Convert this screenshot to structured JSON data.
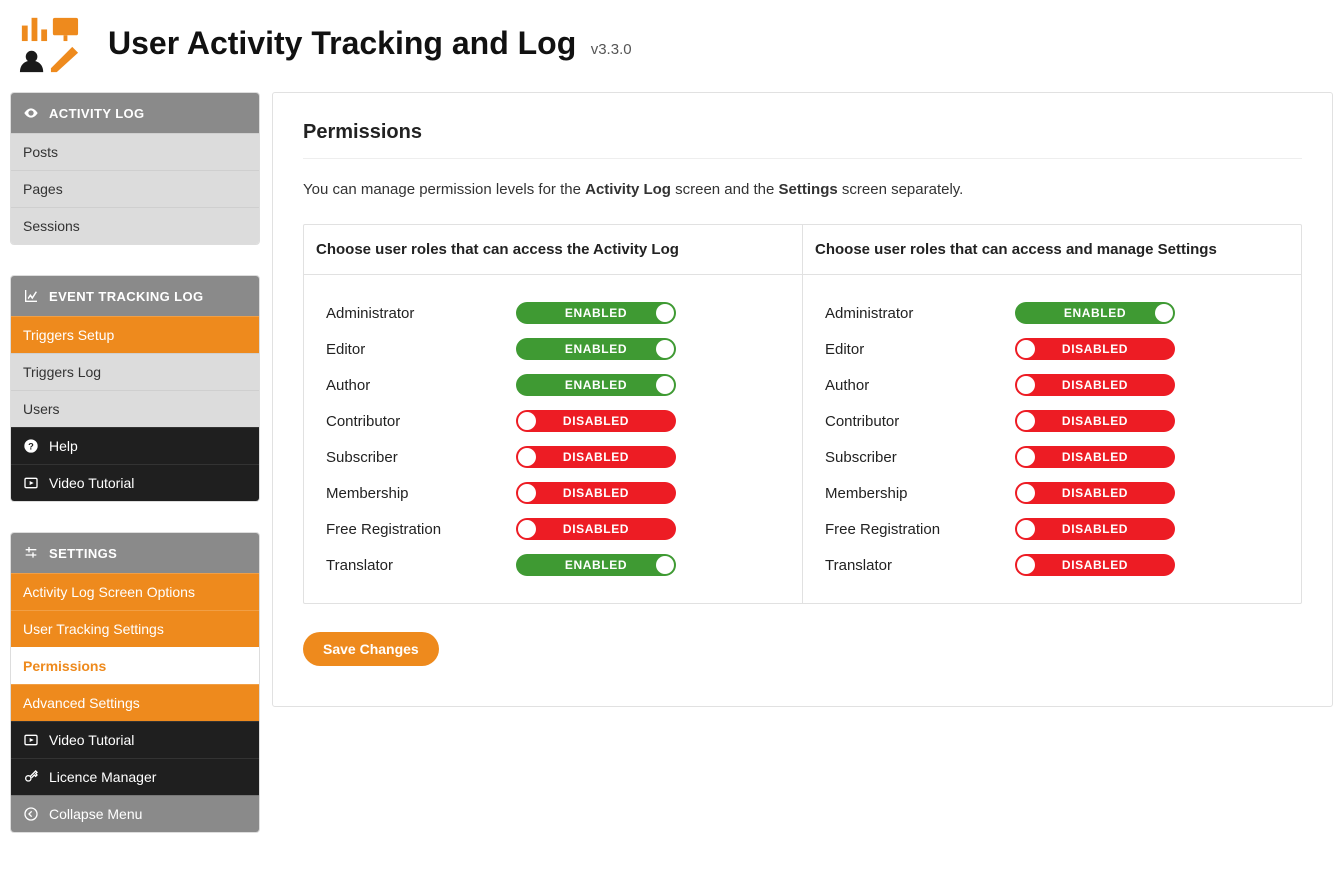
{
  "header": {
    "title": "User Activity Tracking and Log",
    "version": "v3.3.0"
  },
  "sidebar": {
    "blocks": [
      {
        "header": "ACTIVITY LOG",
        "items": [
          {
            "label": "Posts",
            "style": "gray"
          },
          {
            "label": "Pages",
            "style": "gray"
          },
          {
            "label": "Sessions",
            "style": "gray"
          }
        ]
      },
      {
        "header": "EVENT TRACKING LOG",
        "items": [
          {
            "label": "Triggers Setup",
            "style": "orange"
          },
          {
            "label": "Triggers Log",
            "style": "gray"
          },
          {
            "label": "Users",
            "style": "gray"
          },
          {
            "label": "Help",
            "style": "dark",
            "icon": "help"
          },
          {
            "label": "Video Tutorial",
            "style": "dark",
            "icon": "video"
          }
        ]
      },
      {
        "header": "SETTINGS",
        "items": [
          {
            "label": "Activity Log Screen Options",
            "style": "orange"
          },
          {
            "label": "User Tracking Settings",
            "style": "orange"
          },
          {
            "label": "Permissions",
            "style": "orange",
            "active": true
          },
          {
            "label": "Advanced Settings",
            "style": "orange"
          },
          {
            "label": "Video Tutorial",
            "style": "dark",
            "icon": "video"
          },
          {
            "label": "Licence Manager",
            "style": "dark",
            "icon": "key"
          },
          {
            "label": "Collapse Menu",
            "style": "gray-footer",
            "icon": "collapse"
          }
        ]
      }
    ]
  },
  "main": {
    "title": "Permissions",
    "intro_pre": "You can manage permission levels for the ",
    "intro_b1": "Activity Log",
    "intro_mid": " screen and the ",
    "intro_b2": "Settings",
    "intro_post": " screen separately.",
    "col1_header": "Choose user roles that can access the Activity Log",
    "col2_header": "Choose user roles that can access and manage Settings",
    "labels": {
      "enabled": "ENABLED",
      "disabled": "DISABLED"
    },
    "roles": [
      "Administrator",
      "Editor",
      "Author",
      "Contributor",
      "Subscriber",
      "Membership",
      "Free Registration",
      "Translator"
    ],
    "col1_states": [
      true,
      true,
      true,
      false,
      false,
      false,
      false,
      true
    ],
    "col2_states": [
      true,
      false,
      false,
      false,
      false,
      false,
      false,
      false
    ],
    "save": "Save Changes"
  }
}
